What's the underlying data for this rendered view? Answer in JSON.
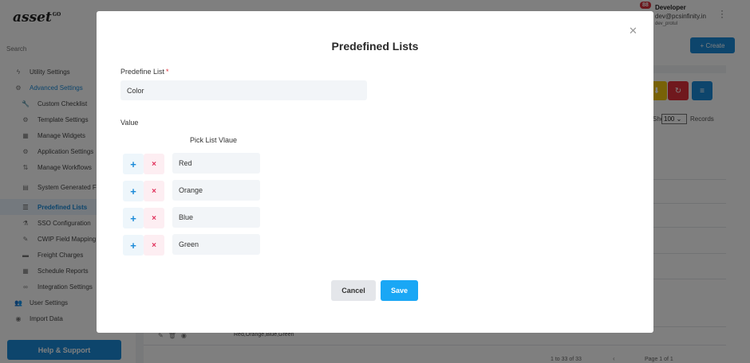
{
  "app": {
    "logo_text": "asset",
    "logo_super": "GO",
    "search_placeholder": "Search",
    "help_button": "Help & Support",
    "create_button": "+ Create",
    "user": {
      "badge": "88",
      "name": "Developer",
      "email": "dev@pcsinfinity.in",
      "id": "dev_protul"
    },
    "sidebar": {
      "items": [
        {
          "label": "Utility Settings",
          "icon": "bolt-icon"
        },
        {
          "label": "Advanced Settings",
          "icon": "gears-icon"
        },
        {
          "label": "Custom Checklist",
          "icon": "wrench-icon"
        },
        {
          "label": "Template Settings",
          "icon": "gear-icon"
        },
        {
          "label": "Manage Widgets",
          "icon": "widgets-icon"
        },
        {
          "label": "Application Settings",
          "icon": "gear-icon"
        },
        {
          "label": "Manage Workflows",
          "icon": "workflow-icon"
        },
        {
          "label": "System Generated Formats",
          "icon": "document-icon"
        },
        {
          "label": "Predefined Lists",
          "icon": "list-icon"
        },
        {
          "label": "SSO Configuration",
          "icon": "flask-icon"
        },
        {
          "label": "CWIP Field Mapping",
          "icon": "pencil-icon"
        },
        {
          "label": "Freight Charges",
          "icon": "truck-icon"
        },
        {
          "label": "Schedule Reports",
          "icon": "calendar-icon"
        },
        {
          "label": "Integration Settings",
          "icon": "link-icon"
        },
        {
          "label": "User Settings",
          "icon": "users-icon"
        },
        {
          "label": "Import Data",
          "icon": "database-icon"
        }
      ]
    },
    "records_label": "Showing",
    "records_value": "100",
    "records_suffix": "Records",
    "row_values": "Red,Orange,Blue,Green",
    "pager_info": "1 to 33 of 33",
    "pager_page": "Page 1 of 1",
    "colors": {
      "primary": "#1a8ad8",
      "save": "#1aa7f5",
      "danger": "#e0305a",
      "toolbar_yellow": "#f1c40f",
      "toolbar_red": "#e0303a",
      "toolbar_blue": "#1a8ad8"
    }
  },
  "modal": {
    "title": "Predefined Lists",
    "field_label": "Predefine List",
    "required_mark": "*",
    "predefine_value": "Color",
    "value_label": "Value",
    "column_header": "Pick List Vlaue",
    "values": [
      "Red",
      "Orange",
      "Blue",
      "Green"
    ],
    "add_icon": "+",
    "remove_icon": "×",
    "cancel_label": "Cancel",
    "save_label": "Save"
  }
}
